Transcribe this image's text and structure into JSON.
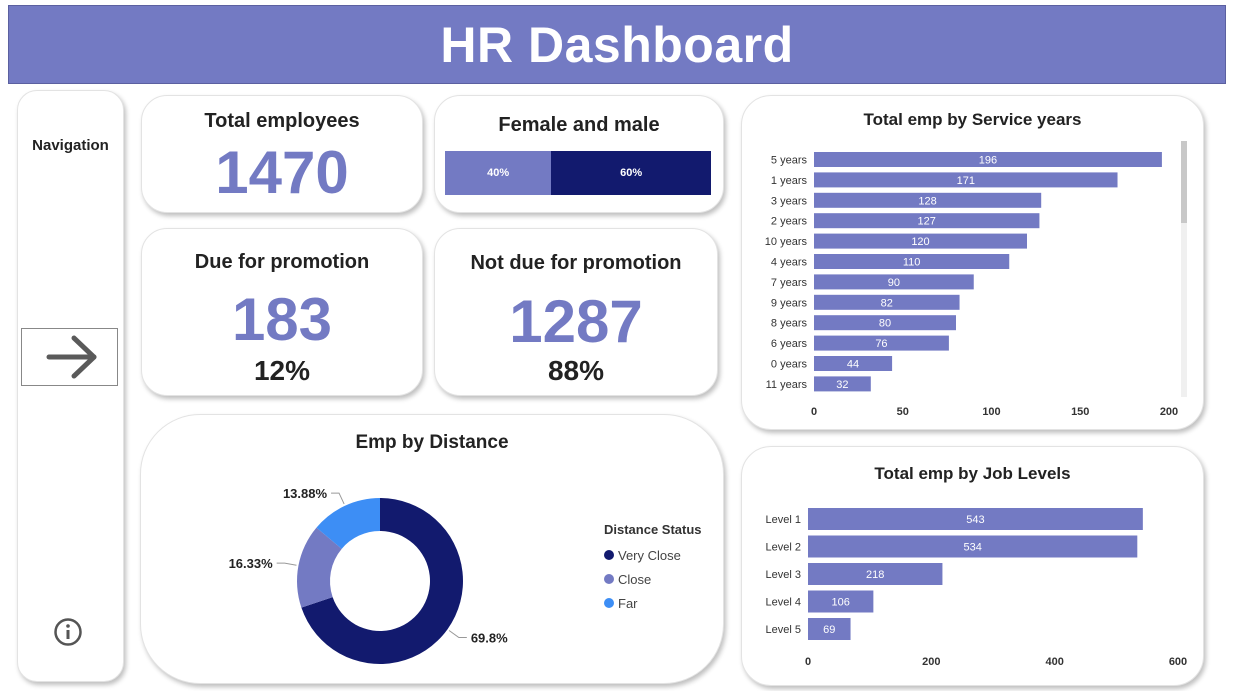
{
  "header": {
    "title": "HR Dashboard"
  },
  "nav": {
    "title": "Navigation",
    "arrow_icon": "arrow-right-icon",
    "info_icon": "info-icon"
  },
  "kpis": {
    "total": {
      "title": "Total employees",
      "value": "1470"
    },
    "gender": {
      "title": "Female and male",
      "female_label": "40%",
      "male_label": "60%",
      "female_fraction": 0.4,
      "male_fraction": 0.6
    },
    "due": {
      "title": "Due for promotion",
      "value": "183",
      "pct": "12%"
    },
    "not_due": {
      "title": "Not due for promotion",
      "value": "1287",
      "pct": "88%"
    }
  },
  "colors": {
    "accent": "#737ac3",
    "navy": "#121a6e",
    "light_blue": "#3d8ef5",
    "header": "#737ac3"
  },
  "chart_data": [
    {
      "type": "pie",
      "title": "Emp by Distance",
      "legend_title": "Distance Status",
      "legend_position": "right",
      "categories": [
        "Very Close",
        "Close",
        "Far"
      ],
      "values": [
        69.8,
        16.33,
        13.88
      ],
      "labels": [
        "69.8%",
        "16.33%",
        "13.88%"
      ],
      "colors": [
        "#121a6e",
        "#737ac3",
        "#3d8ef5"
      ]
    },
    {
      "type": "bar",
      "orientation": "horizontal",
      "title": "Total emp by Service years",
      "categories": [
        "5 years",
        "1 years",
        "3 years",
        "2 years",
        "10 years",
        "4 years",
        "7 years",
        "9 years",
        "8 years",
        "6 years",
        "0 years",
        "11 years"
      ],
      "values": [
        196,
        171,
        128,
        127,
        120,
        110,
        90,
        82,
        80,
        76,
        44,
        32
      ],
      "xlim": [
        0,
        200
      ],
      "xticks": [
        0,
        50,
        100,
        150,
        200
      ]
    },
    {
      "type": "bar",
      "orientation": "horizontal",
      "title": "Total emp by Job Levels",
      "categories": [
        "Level 1",
        "Level 2",
        "Level 3",
        "Level 4",
        "Level 5"
      ],
      "values": [
        543,
        534,
        218,
        106,
        69
      ],
      "xlim": [
        0,
        600
      ],
      "xticks": [
        0,
        200,
        400,
        600
      ]
    }
  ]
}
